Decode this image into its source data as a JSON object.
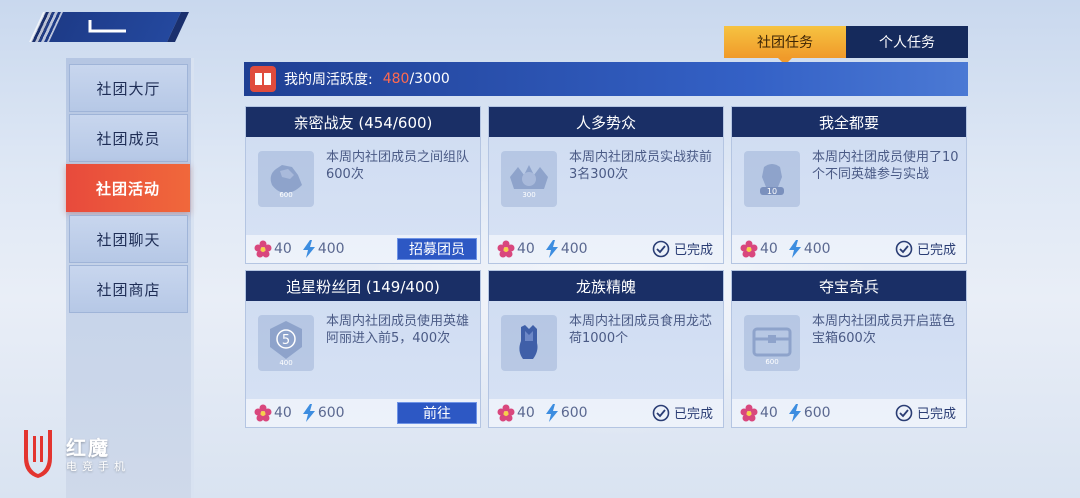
{
  "sidebar": {
    "items": [
      {
        "label": "社团大厅"
      },
      {
        "label": "社团成员"
      },
      {
        "label": "社团活动"
      },
      {
        "label": "社团聊天"
      },
      {
        "label": "社团商店"
      }
    ]
  },
  "tabs": [
    {
      "label": "社团任务"
    },
    {
      "label": "个人任务"
    }
  ],
  "activity": {
    "label": "我的周活跃度:",
    "current": "480",
    "max": "/3000"
  },
  "cards": [
    {
      "title": "亲密战友 (454/600)",
      "desc": "本周内社团成员之间组队600次",
      "icon_num": "600",
      "flower": "40",
      "energy": "400",
      "action": "招募团员"
    },
    {
      "title": "人多势众",
      "desc": "本周内社团成员实战获前3名300次",
      "icon_num": "300",
      "flower": "40",
      "energy": "400",
      "status": "已完成"
    },
    {
      "title": "我全都要",
      "desc": "本周内社团成员使用了10个不同英雄参与实战",
      "icon_num": "10",
      "flower": "40",
      "energy": "400",
      "status": "已完成"
    },
    {
      "title": "追星粉丝团 (149/400)",
      "desc": "本周内社团成员使用英雄阿丽进入前5，400次",
      "icon_num": "400",
      "icon_top": "5",
      "flower": "40",
      "energy": "600",
      "action": "前往"
    },
    {
      "title": "龙族精魄",
      "desc": "本周内社团成员食用龙芯荷1000个",
      "flower": "40",
      "energy": "600",
      "status": "已完成"
    },
    {
      "title": "夺宝奇兵",
      "desc": "本周内社团成员开启蓝色宝箱600次",
      "icon_num": "600",
      "flower": "40",
      "energy": "600",
      "status": "已完成"
    }
  ],
  "logo": {
    "title": "红魔",
    "subtitle": "电竞手机"
  },
  "colors": {
    "accent_orange": "#f09a2a",
    "active_red": "#e84a3c",
    "navy": "#1a2f66",
    "button_blue": "#2d58c4"
  }
}
